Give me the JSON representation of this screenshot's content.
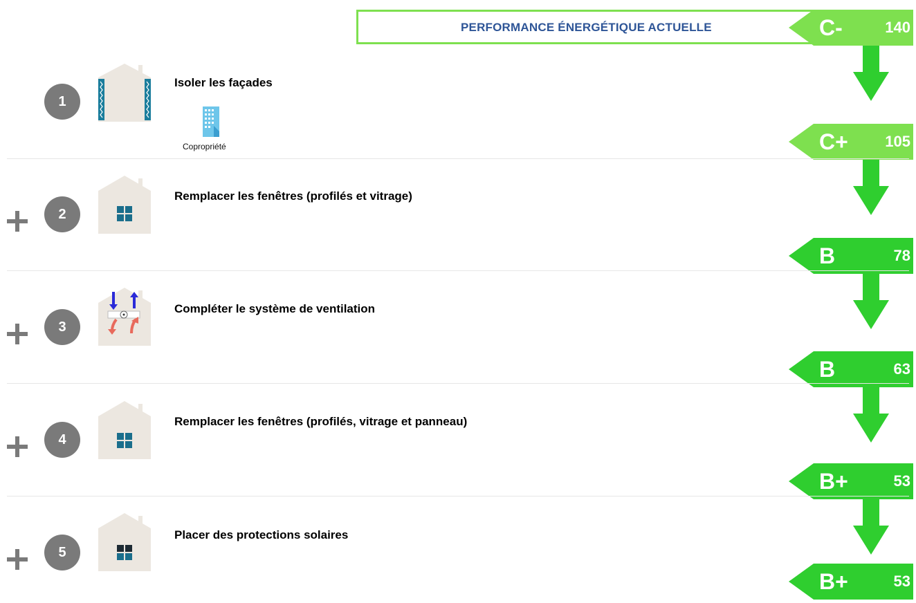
{
  "header": {
    "title": "PERFORMANCE ÉNERGÉTIQUE ACTUELLE"
  },
  "colors": {
    "header_border": "#7ee04f",
    "header_text": "#2e5597",
    "label_green": "#2fce2f",
    "label_light_green": "#7ee04f",
    "arrow_green": "#2fce2f",
    "circle_gray": "#7a7a7a"
  },
  "labels": [
    {
      "grade": "C-",
      "value": "140",
      "color": "#7ee04f"
    },
    {
      "grade": "C+",
      "value": "105",
      "color": "#7ee04f"
    },
    {
      "grade": "B",
      "value": "78",
      "color": "#2fce2f"
    },
    {
      "grade": "B",
      "value": "63",
      "color": "#2fce2f"
    },
    {
      "grade": "B+",
      "value": "53",
      "color": "#2fce2f"
    },
    {
      "grade": "B+",
      "value": "53",
      "color": "#2fce2f"
    }
  ],
  "steps": [
    {
      "number": "1",
      "title": "Isoler les façades",
      "icon": "house-facade-insulation-icon",
      "badge": "Copropriété",
      "badge_icon": "building-icon"
    },
    {
      "number": "2",
      "title": "Remplacer les fenêtres (profilés et vitrage)",
      "icon": "house-window-icon"
    },
    {
      "number": "3",
      "title": "Compléter le système de ventilation",
      "icon": "house-ventilation-icon"
    },
    {
      "number": "4",
      "title": "Remplacer les fenêtres (profilés, vitrage et panneau)",
      "icon": "house-window-icon"
    },
    {
      "number": "5",
      "title": "Placer des protections solaires",
      "icon": "house-solar-protection-icon"
    }
  ]
}
